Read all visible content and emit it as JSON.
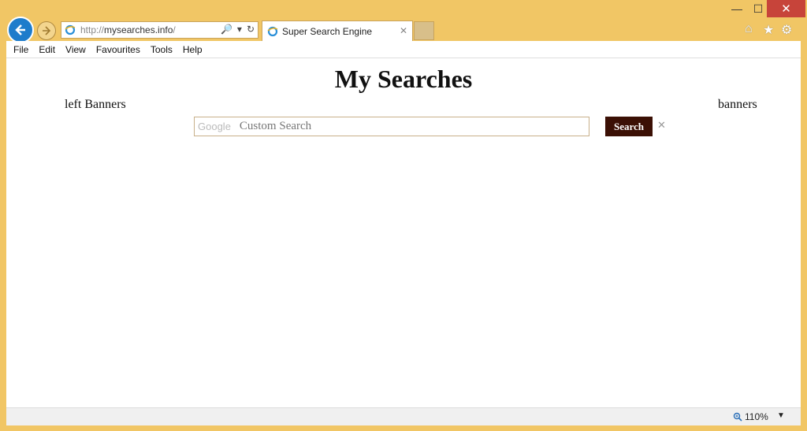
{
  "window": {
    "minimize": "—",
    "maximize": "☐",
    "close": "✕"
  },
  "address": {
    "prefix": "http://",
    "domain": "mysearches.info",
    "suffix": "/",
    "search_icon": "🔎",
    "dropdown": "▾",
    "refresh": "↻"
  },
  "tab": {
    "title": "Super Search Engine",
    "close": "✕"
  },
  "right_icons": {
    "home": "⌂",
    "favorites": "★",
    "settings": "⚙"
  },
  "menu": [
    "File",
    "Edit",
    "View",
    "Favourites",
    "Tools",
    "Help"
  ],
  "page": {
    "title": "My Searches",
    "left_banner": "left Banners",
    "right_banner": "banners",
    "search_brand": "Google",
    "search_placeholder": "Custom Search",
    "search_button": "Search",
    "clear": "✕"
  },
  "status": {
    "zoom": "110%",
    "zoom_dropdown": "▼"
  },
  "colors": {
    "frame": "#f1c665",
    "back_button": "#1e7ccb",
    "close_button": "#c7443a",
    "search_button": "#3b1005"
  }
}
